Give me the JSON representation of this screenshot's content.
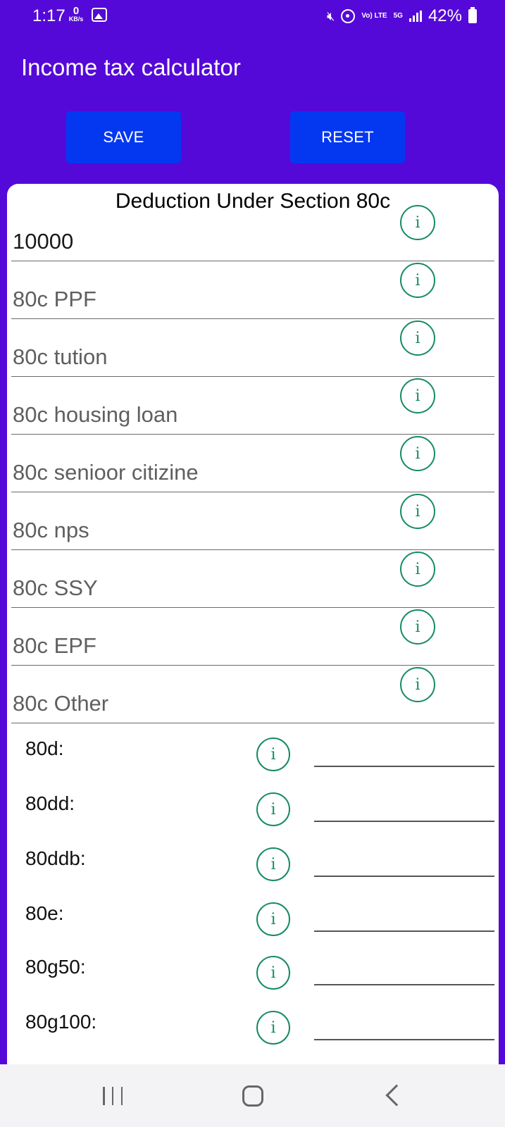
{
  "status_bar": {
    "time": "1:17",
    "data_speed_value": "0",
    "data_speed_unit": "KB/s",
    "volte_label": "Vo) LTE",
    "network_label": "5G",
    "battery_percent": "42%"
  },
  "app_bar": {
    "title": "Income tax calculator"
  },
  "actions": {
    "save_label": "SAVE",
    "reset_label": "RESET"
  },
  "section_80c": {
    "title": "Deduction Under Section 80c",
    "info_glyph": "i",
    "fields": [
      {
        "value": "10000",
        "placeholder": "",
        "filled": true
      },
      {
        "value": "",
        "placeholder": "80c PPF",
        "filled": false
      },
      {
        "value": "",
        "placeholder": "80c tution",
        "filled": false
      },
      {
        "value": "",
        "placeholder": "80c housing loan",
        "filled": false
      },
      {
        "value": "",
        "placeholder": "80c senioor citizine",
        "filled": false
      },
      {
        "value": "",
        "placeholder": "80c nps",
        "filled": false
      },
      {
        "value": "",
        "placeholder": "80c SSY",
        "filled": false
      },
      {
        "value": "",
        "placeholder": "80c EPF",
        "filled": false
      },
      {
        "value": "",
        "placeholder": "80c Other",
        "filled": false
      }
    ]
  },
  "other_deductions": [
    {
      "label": "80d:",
      "value": ""
    },
    {
      "label": "80dd:",
      "value": ""
    },
    {
      "label": "80ddb:",
      "value": ""
    },
    {
      "label": "80e:",
      "value": ""
    },
    {
      "label": "80g50:",
      "value": ""
    },
    {
      "label": "80g100:",
      "value": ""
    }
  ],
  "colors": {
    "app_bar_bg": "#5509d8",
    "button_bg": "#0438f0",
    "info_icon": "#168a68"
  },
  "icons": {
    "nav_recents": "recents-icon",
    "nav_home": "home-icon",
    "nav_back": "back-icon"
  }
}
